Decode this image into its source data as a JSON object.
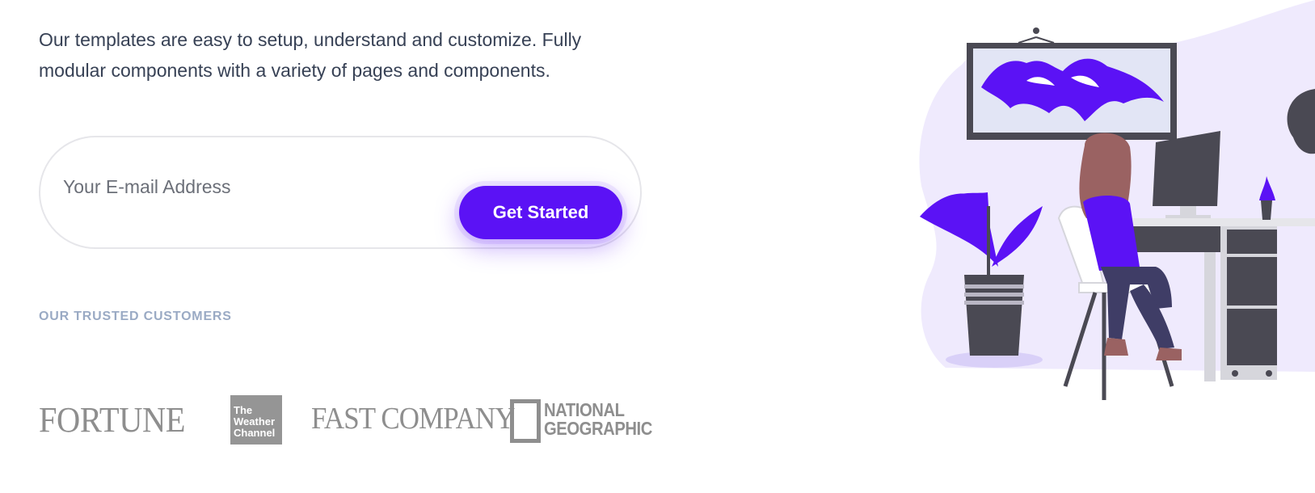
{
  "hero": {
    "description": "Our templates are easy to setup, understand and customize. Fully modular components with a variety of pages and components."
  },
  "signup": {
    "email_placeholder": "Your E-mail Address",
    "cta_label": "Get Started"
  },
  "customers": {
    "heading": "OUR TRUSTED CUSTOMERS",
    "logos": {
      "fortune": "FORTUNE",
      "weather_line1": "The",
      "weather_line2": "Weather",
      "weather_line3": "Channel",
      "fast_company": "FAST COMPANY",
      "natgeo_line1": "NATIONAL",
      "natgeo_line2": "GEOGRAPHIC"
    }
  },
  "colors": {
    "accent": "#5b12f5",
    "text": "#374155",
    "muted_heading": "#9aaac4",
    "logo_gray": "#8e8e8e",
    "illustration_dark": "#4a4953",
    "illustration_bg": "#efeafd",
    "skin_hair": "#9a6262"
  },
  "illustration": {
    "icon": "woman-at-desk-illustration"
  }
}
